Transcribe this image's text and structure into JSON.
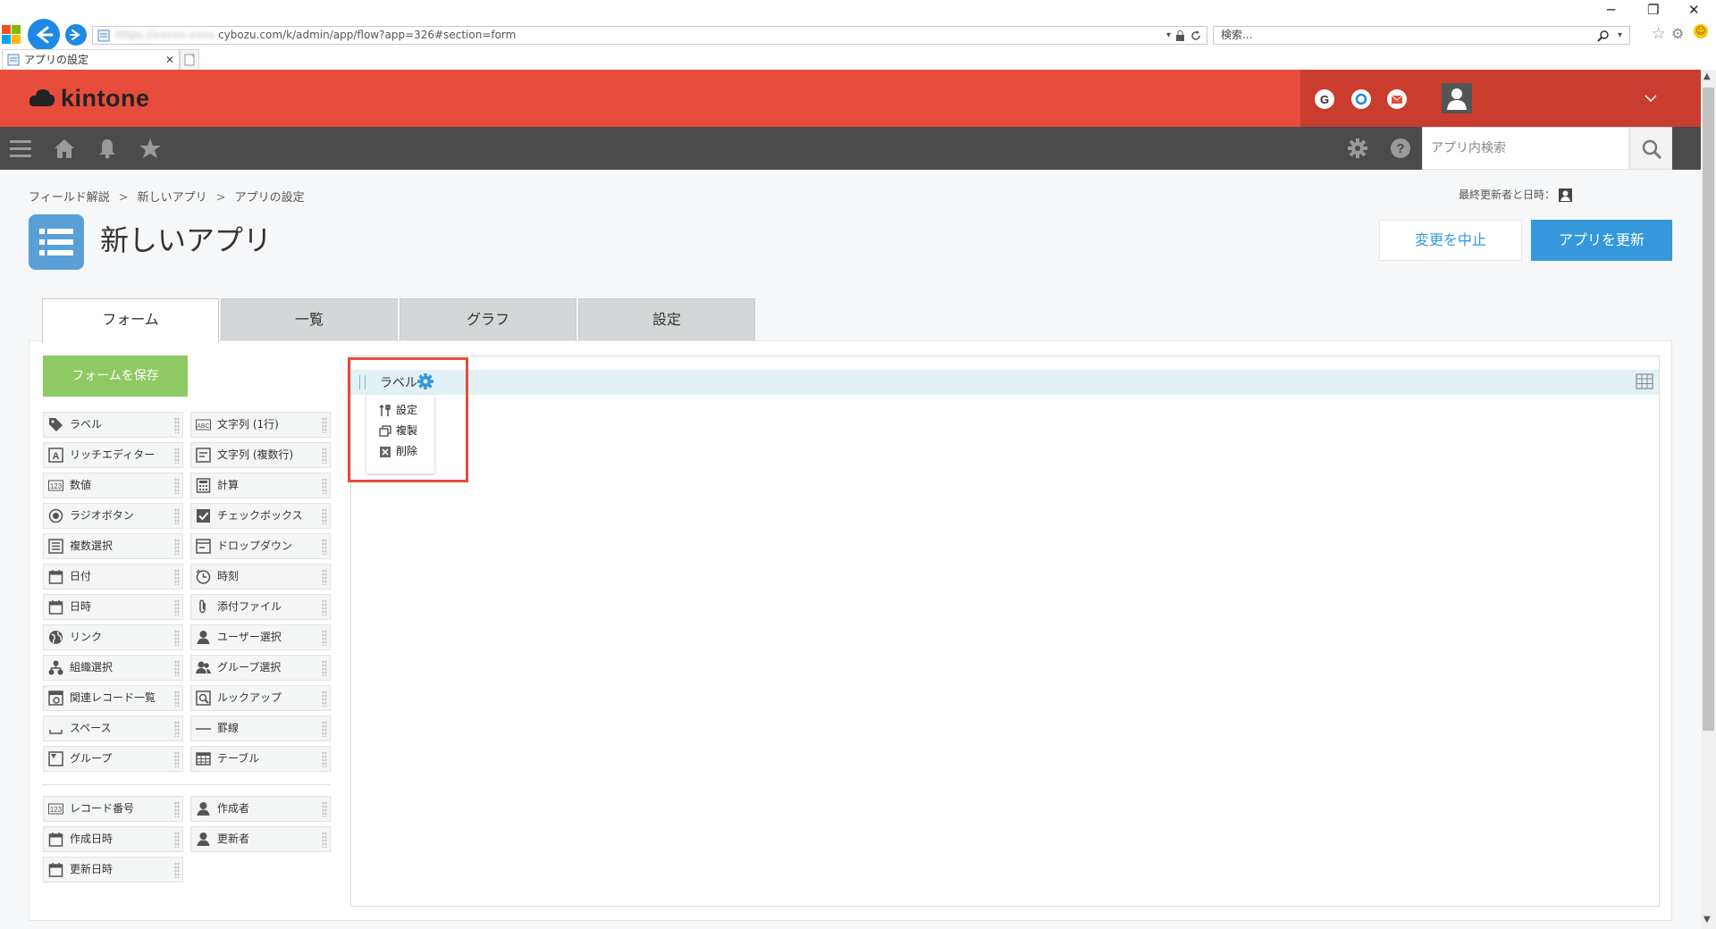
{
  "browser": {
    "url_host": "cybozu.com",
    "url_path": "/k/admin/app/flow?app=326#section=form",
    "search_placeholder": "検索...",
    "tab_title": "アプリの設定"
  },
  "header": {
    "brand": "kintone"
  },
  "nav": {
    "search_placeholder": "アプリ内検索"
  },
  "breadcrumb": [
    "フィールド解説",
    "新しいアプリ",
    "アプリの設定"
  ],
  "breadcrumb_sep": ">",
  "last_updated_label": "最終更新者と日時：",
  "app_title": "新しいアプリ",
  "actions": {
    "cancel": "変更を中止",
    "update": "アプリを更新"
  },
  "tabs": [
    "フォーム",
    "一覧",
    "グラフ",
    "設定"
  ],
  "form": {
    "save_label": "フォームを保存",
    "fields_left": [
      "ラベル",
      "リッチエディター",
      "数値",
      "ラジオボタン",
      "複数選択",
      "日付",
      "日時",
      "リンク",
      "組織選択",
      "関連レコード一覧",
      "スペース",
      "グループ"
    ],
    "fields_right": [
      "文字列 (1行)",
      "文字列 (複数行)",
      "計算",
      "チェックボックス",
      "ドロップダウン",
      "時刻",
      "添付ファイル",
      "ユーザー選択",
      "グループ選択",
      "ルックアップ",
      "罫線",
      "テーブル"
    ],
    "system_left": [
      "レコード番号",
      "作成日時",
      "更新日時"
    ],
    "system_right": [
      "作成者",
      "更新者"
    ]
  },
  "canvas": {
    "label_field": "ラベル",
    "menu": [
      "設定",
      "複製",
      "削除"
    ]
  },
  "colors": {
    "header_red": "#e74c3c",
    "accent_blue": "#3498db",
    "save_green": "#8ec963",
    "highlight_red": "#e74c3c"
  }
}
